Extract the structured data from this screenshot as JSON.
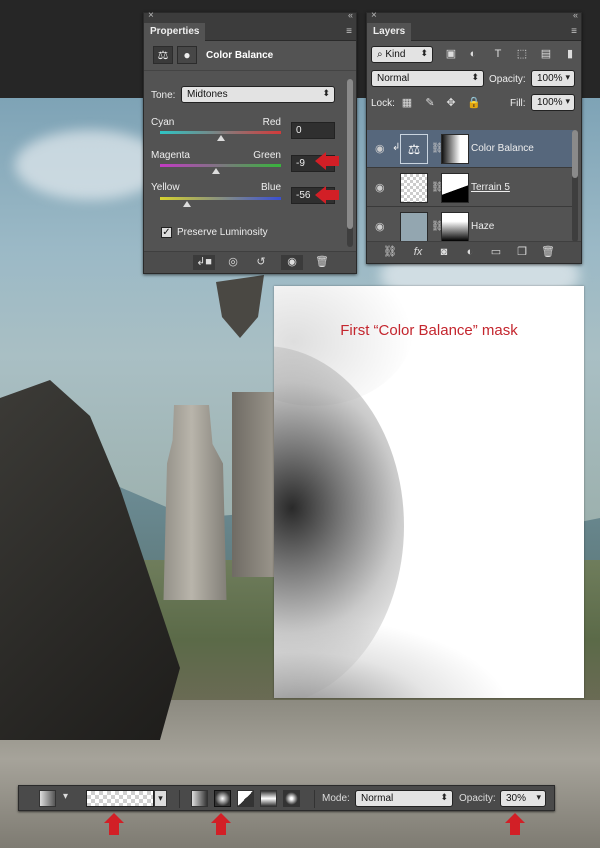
{
  "mask_preview": {
    "caption": "First “Color Balance” mask"
  },
  "properties": {
    "tab": "Properties",
    "close": "×",
    "collapse": "«",
    "menu": "≡",
    "adjustment_icon": "⚖",
    "mask_icon": "●",
    "title": "Color Balance",
    "tone_label": "Tone:",
    "tone_value": "Midtones",
    "sliders": [
      {
        "left": "Cyan",
        "right": "Red",
        "value": "0",
        "level": 0.5,
        "gradient": [
          "#2ec5c5",
          "#d33a3a"
        ]
      },
      {
        "left": "Magenta",
        "right": "Green",
        "value": "-9",
        "level": 0.46,
        "gradient": [
          "#c23ac4",
          "#37b43b"
        ]
      },
      {
        "left": "Yellow",
        "right": "Blue",
        "value": "-56",
        "level": 0.22,
        "gradient": [
          "#d6d22e",
          "#3a4fd3"
        ]
      }
    ],
    "preserve_label": "Preserve Luminosity",
    "preserve_checked": "✓",
    "footer_icons": [
      "clip-to-layer-icon",
      "view-previous-icon",
      "reset-icon",
      "visibility-icon",
      "delete-icon"
    ]
  },
  "layers": {
    "tab": "Layers",
    "kind_label": "Kind",
    "blend_mode": "Normal",
    "opacity_label": "Opacity:",
    "opacity_value": "100%",
    "lock_label": "Lock:",
    "fill_label": "Fill:",
    "fill_value": "100%",
    "items": [
      {
        "name": "Color Balance",
        "selected": true
      },
      {
        "name": "Terrain 5",
        "selected": false
      },
      {
        "name": "Haze",
        "selected": false
      }
    ]
  },
  "options_bar": {
    "mode_label": "Mode:",
    "mode_value": "Normal",
    "opacity_label": "Opacity:",
    "opacity_value": "30%"
  },
  "colors": {
    "accent_red": "#d21f26",
    "caption_red": "#c4262e",
    "panel_bg": "#535353",
    "selected_layer": "#56677c"
  }
}
